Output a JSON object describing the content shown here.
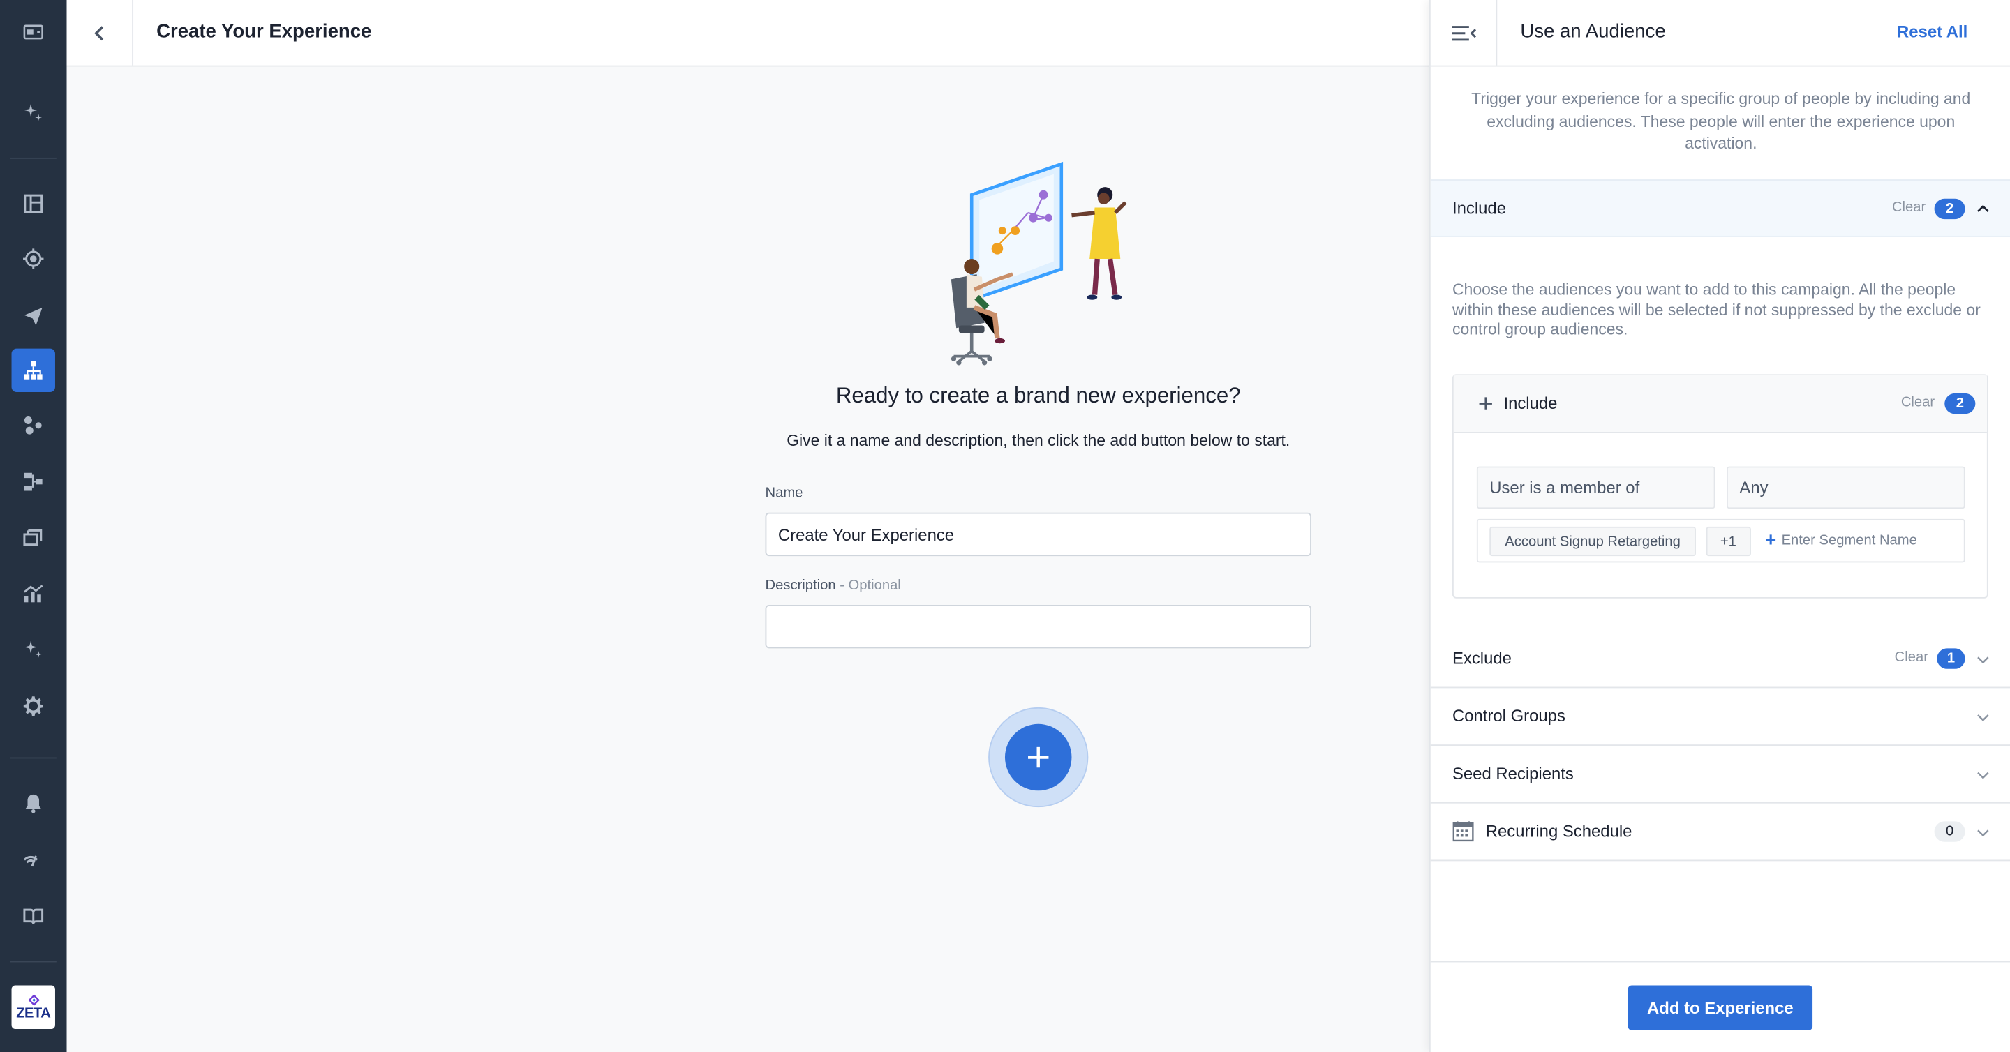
{
  "header": {
    "title": "Create Your Experience"
  },
  "nav": {
    "items": [
      {
        "name": "ai-sparkle-icon"
      },
      {
        "name": "dashboard-icon"
      },
      {
        "name": "target-icon"
      },
      {
        "name": "send-icon"
      },
      {
        "name": "experience-hierarchy-icon",
        "active": true
      },
      {
        "name": "segments-icon"
      },
      {
        "name": "flow-icon"
      },
      {
        "name": "library-icon"
      },
      {
        "name": "analytics-icon"
      },
      {
        "name": "ai-sparkle-icon-2"
      },
      {
        "name": "settings-gear-icon"
      },
      {
        "name": "bell-icon"
      },
      {
        "name": "signal-icon"
      },
      {
        "name": "book-icon"
      }
    ],
    "logo_text": "ZETA"
  },
  "main": {
    "heading": "Ready to create a brand new experience?",
    "subheading": "Give it a name and description, then click the add button below to start.",
    "name_label": "Name",
    "name_value": "Create Your Experience",
    "description_label": "Description",
    "description_optional": " - Optional",
    "description_value": "",
    "add_button_symbol": "+"
  },
  "panel": {
    "title": "Use an Audience",
    "reset_all": "Reset All",
    "intro": "Trigger your experience for a specific group of people by including and excluding audiences. These people will enter the experience upon activation.",
    "include": {
      "title": "Include",
      "clear": "Clear",
      "count": "2",
      "description": "Choose the audiences you want to add to this campaign. All the people within these audiences will be selected if not suppressed by the exclude or control group audiences.",
      "box": {
        "title": "Include",
        "clear": "Clear",
        "count": "2",
        "condition": "User is a member of",
        "match": "Any",
        "chip": "Account Signup Retargeting",
        "more": "+1",
        "segment_placeholder": "Enter Segment Name"
      }
    },
    "exclude": {
      "title": "Exclude",
      "clear": "Clear",
      "count": "1"
    },
    "control_groups": {
      "title": "Control Groups"
    },
    "seed_recipients": {
      "title": "Seed Recipients"
    },
    "recurring_schedule": {
      "title": "Recurring Schedule",
      "count": "0"
    },
    "footer_button": "Add to Experience"
  },
  "colors": {
    "accent": "#2e6fd9",
    "nav_bg": "#253141",
    "include_header_bg": "#f3f8fd"
  }
}
